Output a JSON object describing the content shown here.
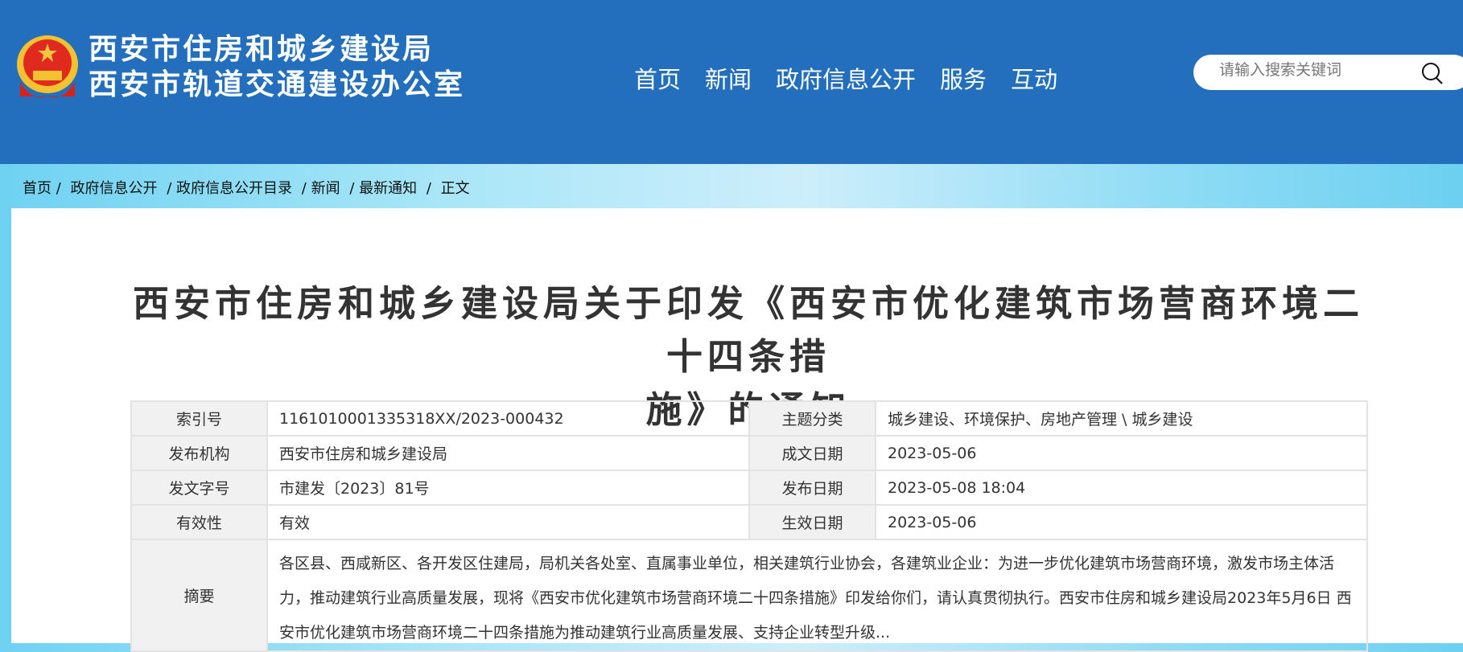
{
  "header": {
    "site_name_line1": "西安市住房和城乡建设局",
    "site_name_line2": "西安市轨道交通建设办公室",
    "nav": [
      "首页",
      "新闻",
      "政府信息公开",
      "服务",
      "互动"
    ],
    "search_placeholder": "请输入搜索关键词"
  },
  "breadcrumb": [
    "首页 /",
    "政府信息公开",
    "/ 政府信息公开目录",
    "/ 新闻",
    "/ 最新通知",
    "/",
    "正文"
  ],
  "article": {
    "title_line1": "西安市住房和城乡建设局关于印发《西安市优化建筑市场营商环境二十四条措",
    "title_line2": "施》的通知"
  },
  "meta": [
    {
      "k1": "索引号",
      "v1": "1161010001335318XX/2023-000432",
      "k2": "主题分类",
      "v2": "城乡建设、环境保护、房地产管理 \\ 城乡建设"
    },
    {
      "k1": "发布机构",
      "v1": "西安市住房和城乡建设局",
      "k2": "成文日期",
      "v2": "2023-05-06"
    },
    {
      "k1": "发文字号",
      "v1": "市建发〔2023〕81号",
      "k2": "发布日期",
      "v2": "2023-05-08 18:04"
    },
    {
      "k1": "有效性",
      "v1": "有效",
      "k2": "生效日期",
      "v2": "2023-05-06"
    }
  ],
  "abstract": {
    "label": "摘要",
    "text": "各区县、西咸新区、各开发区住建局，局机关各处室、直属事业单位，相关建筑行业协会，各建筑业企业：为进一步优化建筑市场营商环境，激发市场主体活力，推动建筑行业高质量发展，现将《西安市优化建筑市场营商环境二十四条措施》印发给你们，请认真贯彻执行。西安市住房和城乡建设局2023年5月6日 西安市优化建筑市场营商环境二十四条措施为推动建筑行业高质量发展、支持企业转型升级..."
  }
}
